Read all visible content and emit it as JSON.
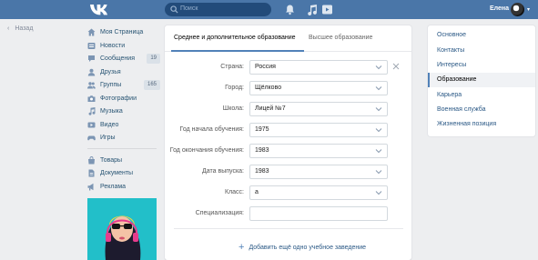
{
  "topbar": {
    "logo": "vk",
    "search_placeholder": "Поиск",
    "user_name": "Елена"
  },
  "back_label": "Назад",
  "nav": [
    {
      "icon": "home-icon",
      "label": "Моя Страница"
    },
    {
      "icon": "news-icon",
      "label": "Новости"
    },
    {
      "icon": "messages-icon",
      "label": "Сообщения",
      "badge": "19"
    },
    {
      "icon": "friends-icon",
      "label": "Друзья"
    },
    {
      "icon": "groups-icon",
      "label": "Группы",
      "badge": "165"
    },
    {
      "icon": "photos-icon",
      "label": "Фотографии"
    },
    {
      "icon": "music-icon",
      "label": "Музыка"
    },
    {
      "icon": "video-icon",
      "label": "Видео"
    },
    {
      "icon": "games-icon",
      "label": "Игры"
    },
    {
      "icon": "goods-icon",
      "label": "Товары"
    },
    {
      "icon": "documents-icon",
      "label": "Документы"
    },
    {
      "icon": "ads-icon",
      "label": "Реклама"
    }
  ],
  "tabs": [
    "Среднее и дополнительное образование",
    "Высшее образование"
  ],
  "form": [
    {
      "label": "Страна:",
      "value": "Россия"
    },
    {
      "label": "Город:",
      "value": "Щёлково"
    },
    {
      "label": "Школа:",
      "value": "Лицей №7"
    },
    {
      "label": "Год начала обучения:",
      "value": "1975"
    },
    {
      "label": "Год окончания обучения:",
      "value": "1983"
    },
    {
      "label": "Дата выпуска:",
      "value": "1983"
    },
    {
      "label": "Класс:",
      "value": "а"
    },
    {
      "label": "Специализация:",
      "value": ""
    }
  ],
  "add_label": "Добавить ещё одно учебное заведение",
  "right_menu": [
    "Основное",
    "Контакты",
    "Интересы",
    "Образование",
    "Карьера",
    "Военная служба",
    "Жизненная позиция"
  ],
  "right_menu_active": "Образование",
  "colors": {
    "header": "#4a76a8",
    "accent": "#5181b8",
    "link": "#2a5885"
  }
}
